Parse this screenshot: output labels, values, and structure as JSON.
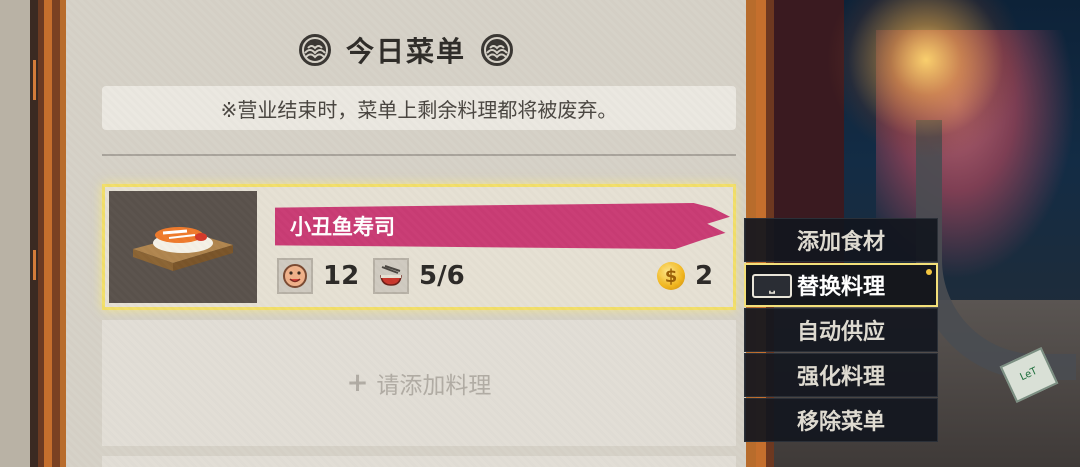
{
  "menu": {
    "title": "今日菜单",
    "notice": "※营业结束时，菜单上剩余料理都将被废弃。"
  },
  "dish": {
    "name": "小丑鱼寿司",
    "taste_value": "12",
    "servings": "5/6",
    "price": "2",
    "coin_symbol": "$",
    "taste_icon": "taste-face-icon",
    "bowl_icon": "bowl-icon",
    "coin_icon": "gold-coin-icon"
  },
  "empty_slot": {
    "plus": "+",
    "label": "请添加料理"
  },
  "context_menu": {
    "items": [
      {
        "label": "添加食材"
      },
      {
        "label": "替换料理",
        "selected": true,
        "key_hint": "⎵"
      },
      {
        "label": "自动供应"
      },
      {
        "label": "强化料理"
      },
      {
        "label": "移除菜单"
      }
    ]
  },
  "scene": {
    "sign_text": "LeT"
  },
  "colors": {
    "parchment": "#d6d1c7",
    "frame": "#b86c2c",
    "dish_band": "#c93c74",
    "highlight": "#f2df6a"
  }
}
